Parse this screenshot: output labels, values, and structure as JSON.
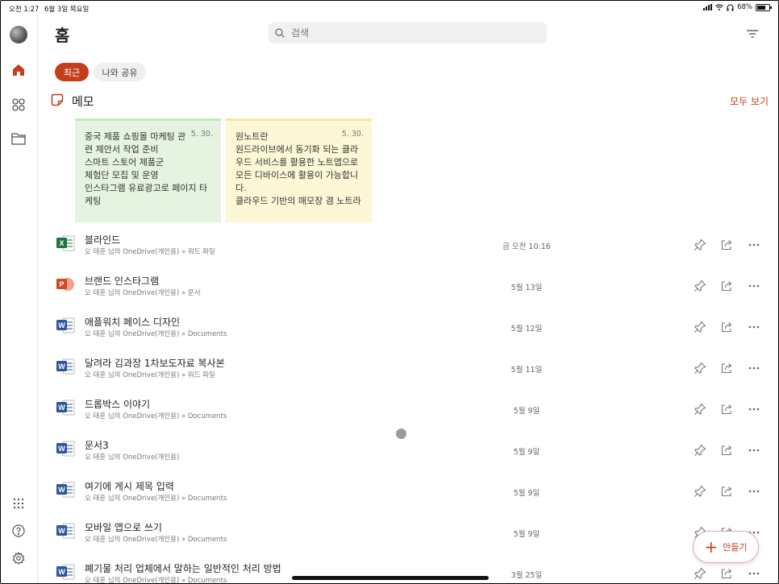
{
  "status_bar": {
    "time": "오전 1:27",
    "date": "6월 3일 목요일",
    "battery": "68%"
  },
  "header": {
    "title": "홈",
    "search_placeholder": "검색"
  },
  "tabs": [
    {
      "label": "최근"
    },
    {
      "label": "나와 공유"
    }
  ],
  "notes": {
    "title": "메모",
    "see_all": "모두 보기",
    "cards": [
      {
        "date": "5. 30.",
        "lines": [
          "중국 제품 쇼핑몰 마케팅 관",
          "련 제안서 작업 준비",
          "스마트 스토어 제품군",
          "체험단 모집 및 운영",
          "인스타그램 유료광고로 페이지 타",
          "케팅"
        ]
      },
      {
        "date": "5. 30.",
        "lines": [
          "원노트란",
          "원드라이브에서 동기화 되는 클라",
          "우드 서비스를 활용한 노트앱으로",
          "모든 디바이스에 활용이 가능합니",
          "다.",
          "클라우드 기반의 매모장 겸 노트라"
        ]
      }
    ]
  },
  "files": [
    {
      "name": "블라인드",
      "path": "오 태훈 님의 OneDrive(개인용) » 워드 파일",
      "date": "금 오전 10:16",
      "type": "excel"
    },
    {
      "name": "브랜드 인스타그램",
      "path": "오 태훈 님의 OneDrive(개인용) » 문서",
      "date": "5월 13일",
      "type": "powerpoint"
    },
    {
      "name": "애플워치 페이스 디자인",
      "path": "오 태훈 님의 OneDrive(개인용) » Documents",
      "date": "5월 12일",
      "type": "word"
    },
    {
      "name": "달려라 김과장 1차보도자료 복사본",
      "path": "오 태훈 님의 OneDrive(개인용) » 워드 파일",
      "date": "5월 11일",
      "type": "word"
    },
    {
      "name": "드롭박스 이야기",
      "path": "오 태훈 님의 OneDrive(개인용) » Documents",
      "date": "5월 9일",
      "type": "word"
    },
    {
      "name": "문서3",
      "path": "오 태훈 님의 OneDrive(개인용)",
      "date": "5월 9일",
      "type": "word"
    },
    {
      "name": "여기에 게시 제목 입력",
      "path": "오 태훈 님의 OneDrive(개인용) » Documents",
      "date": "5월 9일",
      "type": "word"
    },
    {
      "name": "모바일 앱으로 쓰기",
      "path": "오 태훈 님의 OneDrive(개인용) » Documents",
      "date": "5월 9일",
      "type": "word"
    },
    {
      "name": "폐기물 처리 업체에서 말하는 일반적인 처리 방법",
      "path": "오 태훈 님의 OneDrive(개인용) » Documents",
      "date": "3월 25일",
      "type": "word"
    }
  ],
  "create_button": {
    "label": "만들기"
  },
  "colors": {
    "accent": "#c43e1c",
    "word": "#2b579a",
    "excel": "#217346",
    "powerpoint": "#d24726",
    "note_green": "#e5f3e1",
    "note_yellow": "#fdf7d6"
  }
}
